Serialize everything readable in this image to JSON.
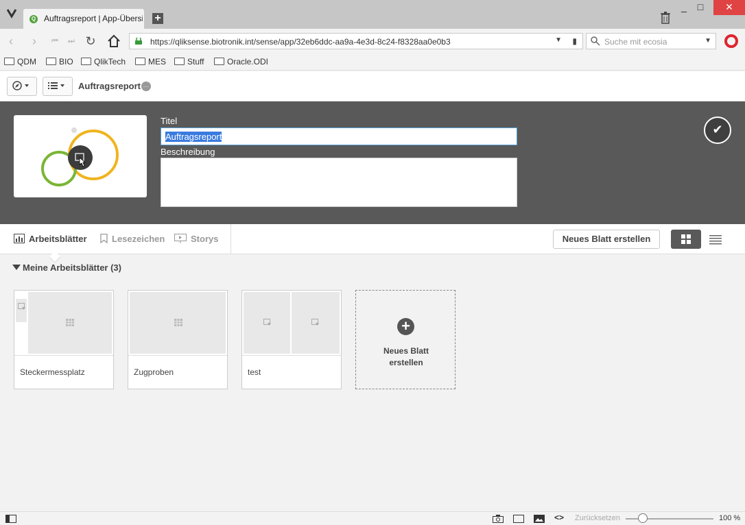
{
  "browser": {
    "tab_title": "Auftragsreport | App-Übersicht",
    "tab_favicon_letter": "Q",
    "url": "https://qliksense.biotronik.int/sense/app/32eb6ddc-aa9a-4e3d-8c24-f8328aa0e0b3",
    "search_placeholder": "Suche mit ecosia",
    "window_controls": [
      "_",
      "□",
      "✕"
    ],
    "bookmarks": [
      "QDM",
      "BIO",
      "QlikTech",
      "MES",
      "Stuff",
      "Oracle.ODI"
    ]
  },
  "toolbar": {
    "app_title": "Auftragsreport",
    "app_status_dot": "···"
  },
  "header": {
    "title_label": "Titel",
    "title_value": "Auftragsreport",
    "description_label": "Beschreibung",
    "description_value": "",
    "confirm_icon": "✔"
  },
  "tabs": {
    "items": [
      {
        "label": "Arbeitsblätter",
        "icon": "chart-icon",
        "active": true
      },
      {
        "label": "Lesezeichen",
        "icon": "bookmark-icon",
        "active": false
      },
      {
        "label": "Storys",
        "icon": "story-icon",
        "active": false
      }
    ],
    "new_sheet_button": "Neues Blatt erstellen"
  },
  "section": {
    "title": "Meine Arbeitsblätter (3)"
  },
  "sheets": [
    {
      "name": "Steckermessplatz"
    },
    {
      "name": "Zugproben"
    },
    {
      "name": "test"
    }
  ],
  "add_sheet": {
    "line1": "Neues Blatt",
    "line2": "erstellen",
    "plus": "+"
  },
  "statusbar": {
    "reset_label": "Zurücksetzen",
    "zoom": "100 %",
    "zoom_level_percent": 100
  },
  "colors": {
    "header_bg": "#595959",
    "accent_selection": "#3a7be0",
    "logo_green": "#7ab535",
    "logo_yellow": "#f0b41e"
  }
}
